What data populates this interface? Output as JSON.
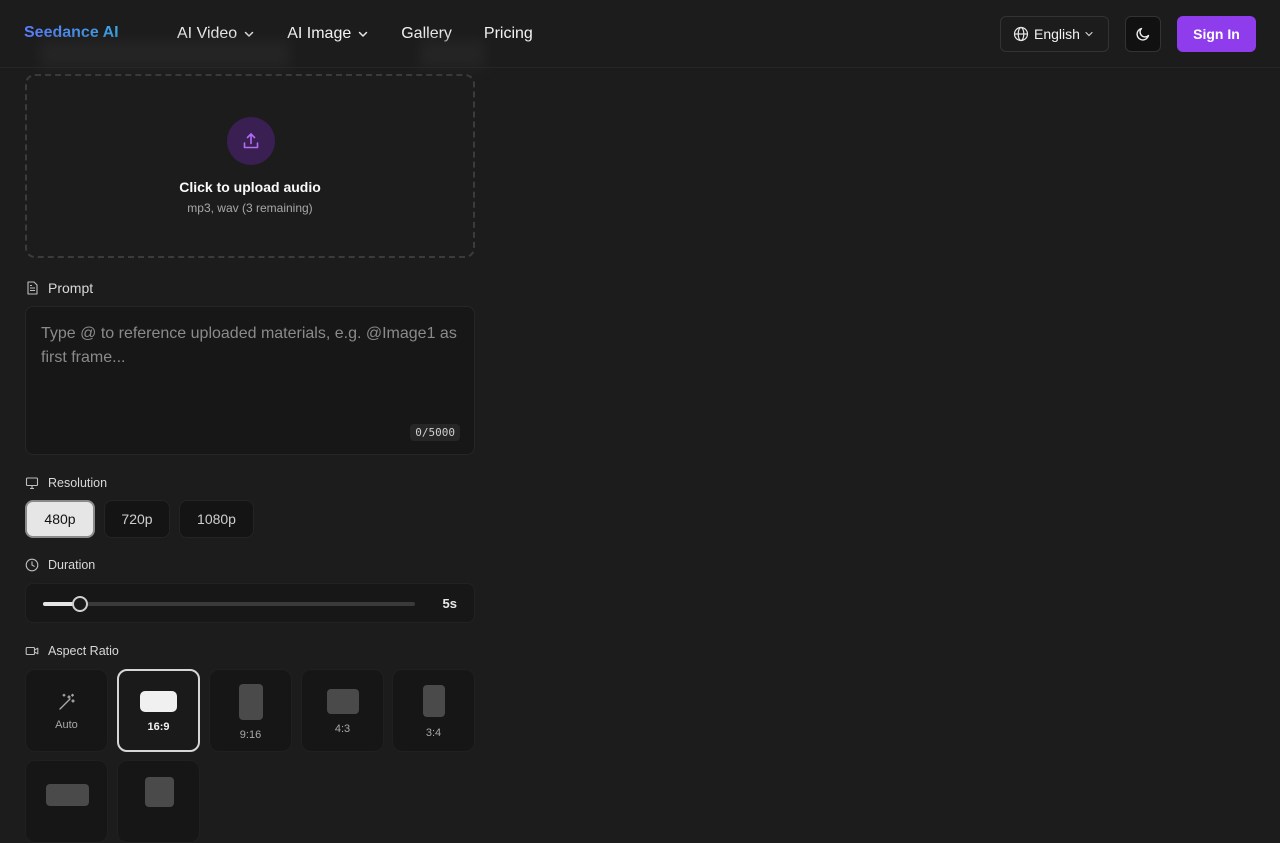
{
  "header": {
    "brand": "Seedance AI",
    "nav": [
      {
        "label": "AI Video",
        "has_dropdown": true
      },
      {
        "label": "AI Image",
        "has_dropdown": true
      },
      {
        "label": "Gallery",
        "has_dropdown": false
      },
      {
        "label": "Pricing",
        "has_dropdown": false
      }
    ],
    "language": "English",
    "theme_icon": "moon-icon",
    "sign_in": "Sign In",
    "accent_color": "#8f3dec"
  },
  "upload": {
    "icon": "upload-icon",
    "title": "Click to upload audio",
    "subtitle": "mp3, wav (3 remaining)"
  },
  "prompt": {
    "label": "Prompt",
    "placeholder": "Type @ to reference uploaded materials, e.g. @Image1 as first frame...",
    "value": "",
    "char_count": "0/5000"
  },
  "resolution": {
    "label": "Resolution",
    "options": [
      "480p",
      "720p",
      "1080p"
    ],
    "selected": "480p"
  },
  "duration": {
    "label": "Duration",
    "value": "5s",
    "level": 0.1
  },
  "aspect_ratio": {
    "label": "Aspect Ratio",
    "options": [
      "Auto",
      "16:9",
      "9:16",
      "4:3",
      "3:4"
    ],
    "selected": "16:9"
  }
}
